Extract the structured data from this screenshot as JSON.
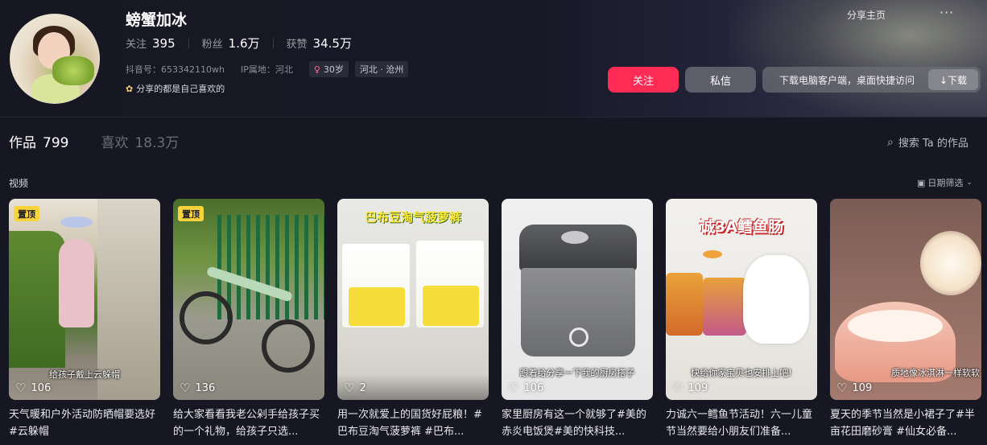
{
  "profile": {
    "name": "螃蟹加冰",
    "stats": [
      {
        "label": "关注",
        "value": "395"
      },
      {
        "label": "粉丝",
        "value": "1.6万"
      },
      {
        "label": "获赞",
        "value": "34.5万"
      }
    ],
    "douyin_id": "抖音号：653342110wh",
    "ip_location": "IP属地：河北",
    "age_tag": "30岁",
    "region_tag": "河北 · 沧州",
    "bio": "分享的都是自己喜欢的"
  },
  "header_actions": {
    "share_home": "分享主页",
    "more": "···",
    "follow": "关注",
    "message": "私信",
    "download_hint": "下载电脑客户端，桌面快捷访问",
    "download_button": "↓下载"
  },
  "tabs": [
    {
      "label": "作品",
      "count": "799",
      "active": true
    },
    {
      "label": "喜欢",
      "count": "18.3万",
      "active": false
    }
  ],
  "search_label": "搜索 Ta 的作品",
  "section_label": "视频",
  "date_filter": "日期筛选",
  "videos": [
    {
      "pinned_label": "置顶",
      "overlay": "给孩子戴上云躲帽",
      "likes": "106",
      "caption": "天气暖和户外活动防晒帽要选好#云躲帽"
    },
    {
      "pinned_label": "置顶",
      "overlay": "",
      "likes": "136",
      "caption": "给大家看看我老公剁手给孩子买的一个礼物，给孩子只选..."
    },
    {
      "banner": "巴布豆淘气菠萝裤",
      "overlay": "",
      "likes": "2",
      "caption": "用一次就爱上的国货好屁粮！#巴布豆淘气菠萝裤 #巴布..."
    },
    {
      "overlay": "跟着给分享一下我的厨房搭子",
      "likes": "106",
      "caption": "家里厨房有这一个就够了#美的赤炎电饭煲#美的快科技..."
    },
    {
      "banner": "诚3A鳕鱼肠",
      "overlay": "快给你家宝贝也安排上吧!",
      "likes": "109",
      "caption": "力诚六一鳕鱼节活动！六一儿童节当然要给小朋友们准备..."
    },
    {
      "overlay": "质地像冰淇淋一样软软",
      "likes": "109",
      "caption": "夏天的季节当然是小裙子了#半亩花田磨砂膏 #仙女必备..."
    }
  ],
  "colors": {
    "background": "#161722",
    "accent": "#fe2c55",
    "pin": "#f9d33b"
  }
}
